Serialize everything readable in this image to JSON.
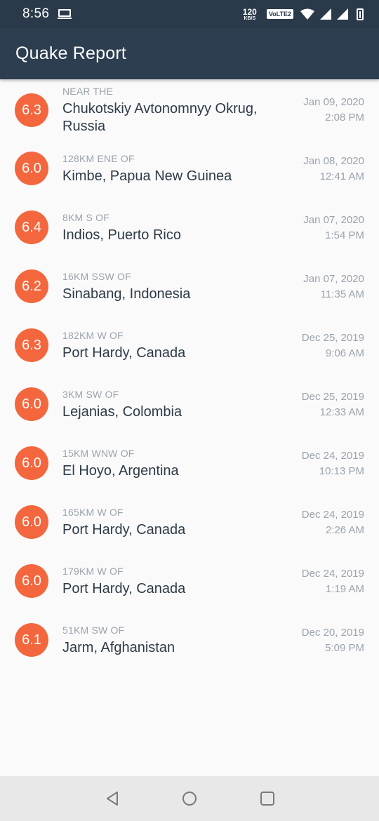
{
  "status_bar": {
    "time": "8:56",
    "net_speed": "120",
    "net_unit": "KB/S",
    "volte": "VoLTE2"
  },
  "app_bar": {
    "title": "Quake Report"
  },
  "colors": {
    "app_bar": "#2c3e50",
    "status_bar": "#2a3a4a",
    "magnitude_circle": "#f4663d"
  },
  "earthquakes": [
    {
      "magnitude": "6.3",
      "offset": "NEAR THE",
      "place_line1": "Chukotskiy Avtonomnyy Okrug,",
      "place_line2": "Russia",
      "date": "Jan 09, 2020",
      "time": "2:08 PM"
    },
    {
      "magnitude": "6.0",
      "offset": "128KM ENE OF",
      "place_line1": "Kimbe, Papua New Guinea",
      "date": "Jan 08, 2020",
      "time": "12:41 AM"
    },
    {
      "magnitude": "6.4",
      "offset": "8KM S OF",
      "place_line1": "Indios, Puerto Rico",
      "date": "Jan 07, 2020",
      "time": "1:54 PM"
    },
    {
      "magnitude": "6.2",
      "offset": "16KM SSW OF",
      "place_line1": "Sinabang, Indonesia",
      "date": "Jan 07, 2020",
      "time": "11:35 AM"
    },
    {
      "magnitude": "6.3",
      "offset": "182KM W OF",
      "place_line1": "Port Hardy, Canada",
      "date": "Dec 25, 2019",
      "time": "9:06 AM"
    },
    {
      "magnitude": "6.0",
      "offset": "3KM SW OF",
      "place_line1": "Lejanias, Colombia",
      "date": "Dec 25, 2019",
      "time": "12:33 AM"
    },
    {
      "magnitude": "6.0",
      "offset": "15KM WNW OF",
      "place_line1": "El Hoyo, Argentina",
      "date": "Dec 24, 2019",
      "time": "10:13 PM"
    },
    {
      "magnitude": "6.0",
      "offset": "165KM W OF",
      "place_line1": "Port Hardy, Canada",
      "date": "Dec 24, 2019",
      "time": "2:26 AM"
    },
    {
      "magnitude": "6.0",
      "offset": "179KM W OF",
      "place_line1": "Port Hardy, Canada",
      "date": "Dec 24, 2019",
      "time": "1:19 AM"
    },
    {
      "magnitude": "6.1",
      "offset": "51KM SW OF",
      "place_line1": "Jarm, Afghanistan",
      "date": "Dec 20, 2019",
      "time": "5:09 PM"
    }
  ],
  "nav_bar": {
    "back": "back-icon",
    "home": "home-icon",
    "recents": "recents-icon"
  }
}
